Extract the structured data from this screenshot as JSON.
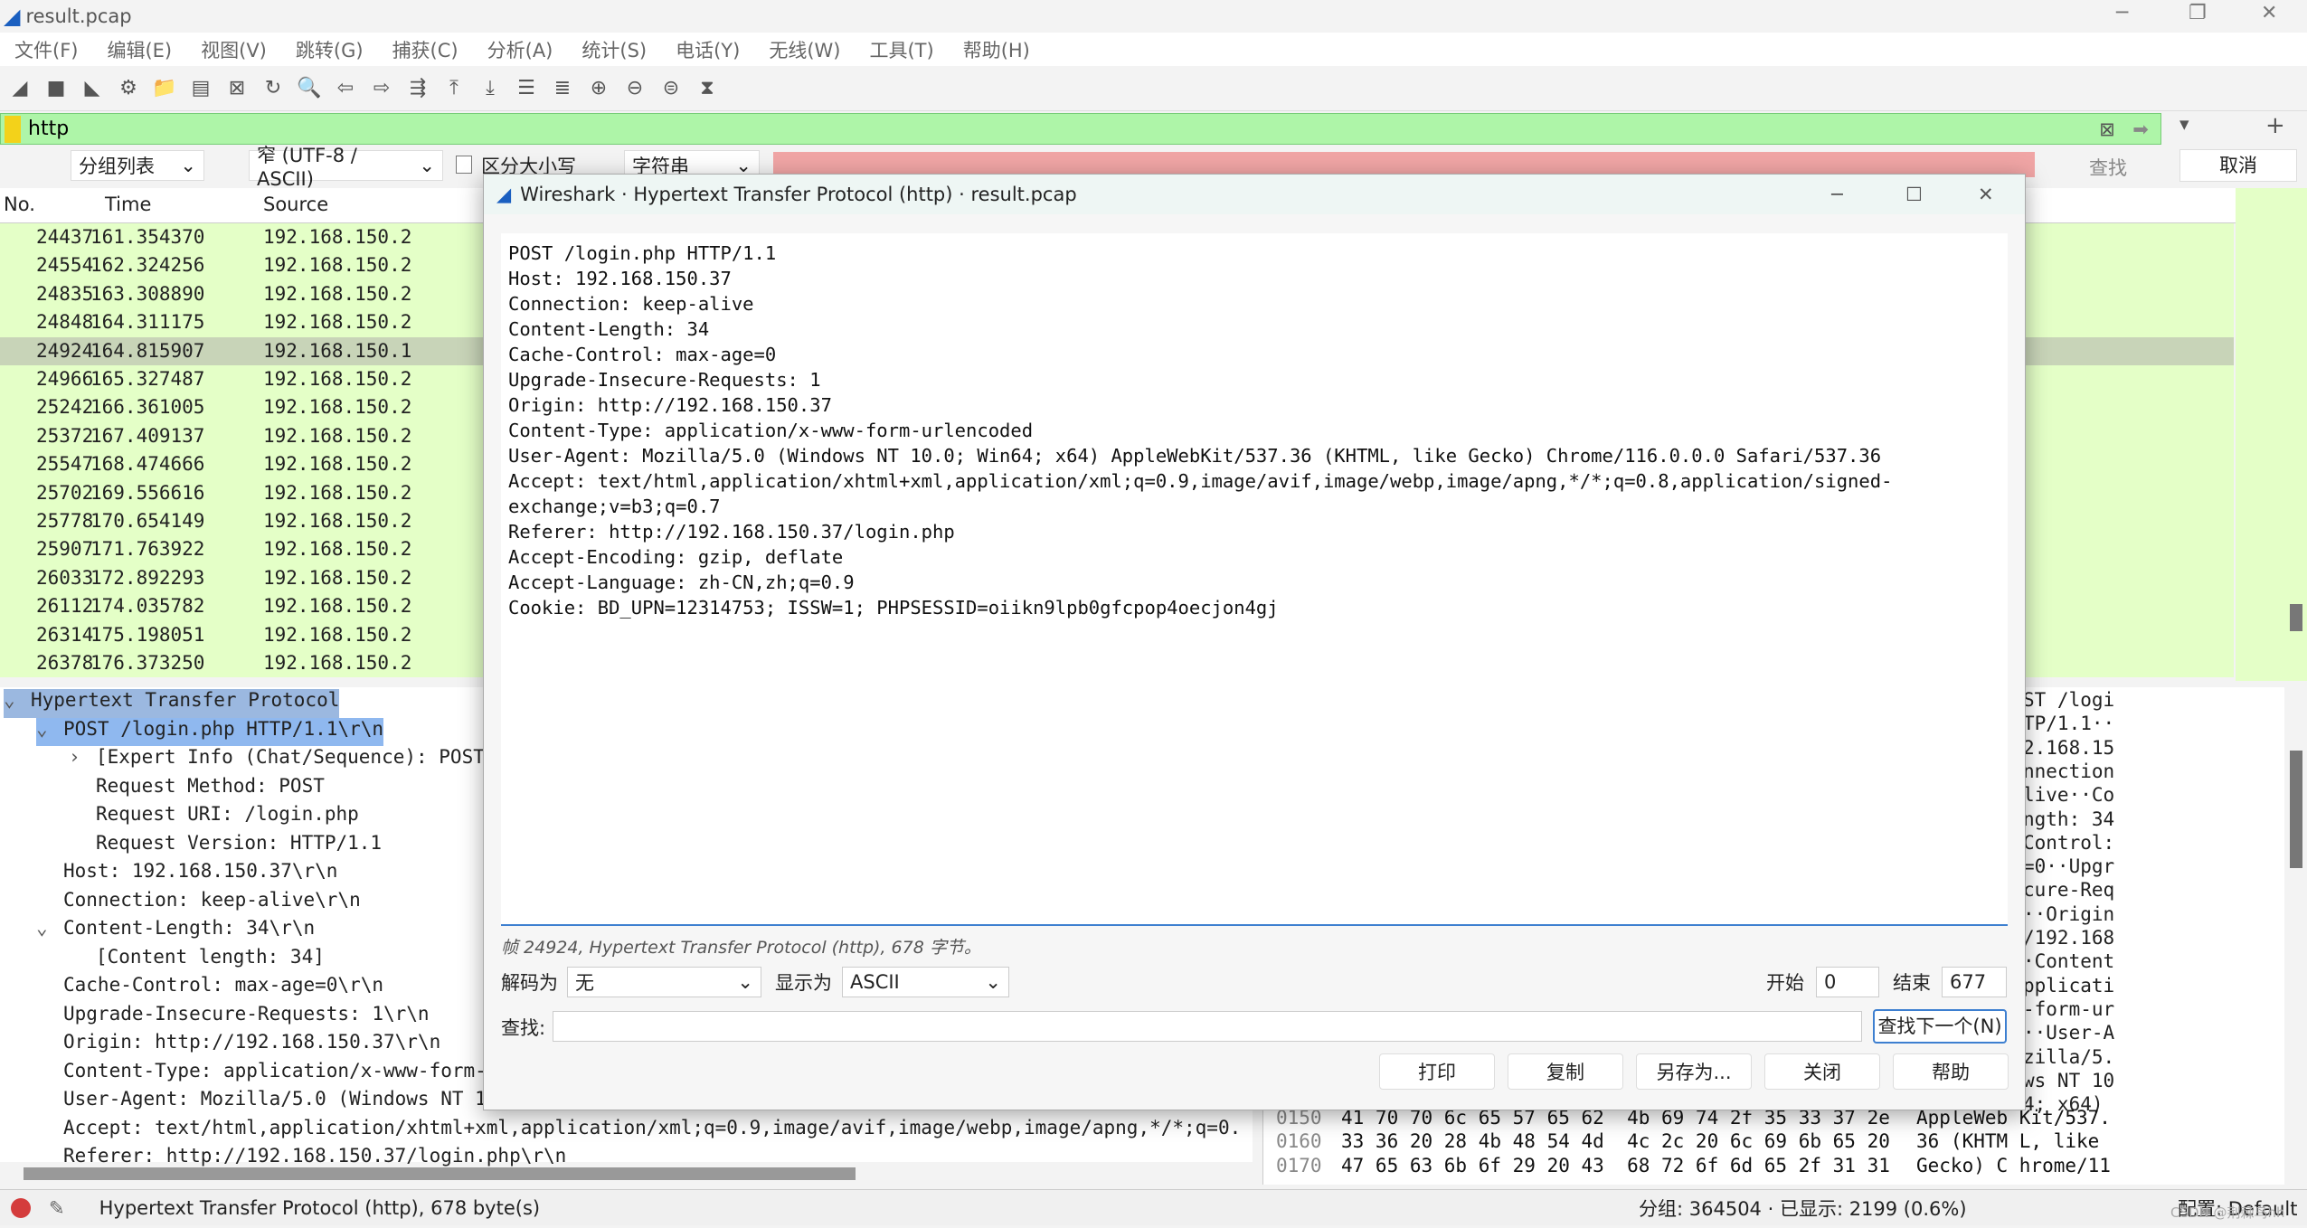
{
  "window": {
    "title": "result.pcap",
    "minimize": "─",
    "maximize": "❐",
    "close": "✕"
  },
  "menu": [
    "文件(F)",
    "编辑(E)",
    "视图(V)",
    "跳转(G)",
    "捕获(C)",
    "分析(A)",
    "统计(S)",
    "电话(Y)",
    "无线(W)",
    "工具(T)",
    "帮助(H)"
  ],
  "toolbar_icons": [
    "shark-fin-start-icon",
    "stop-icon",
    "restart-icon",
    "options-gear-icon",
    "open-folder-icon",
    "file-icon",
    "close-file-icon",
    "reload-icon",
    "find-icon",
    "back-icon",
    "forward-icon",
    "go-to-packet-icon",
    "first-packet-icon",
    "last-packet-icon",
    "autoscroll-icon",
    "colorize-icon",
    "zoom-in-icon",
    "zoom-out-icon",
    "zoom-normal-icon",
    "resize-columns-icon"
  ],
  "filter": {
    "value": "http"
  },
  "findbar": {
    "search_in": "分组列表",
    "charset": "窄 (UTF-8 / ASCII)",
    "case_label": "区分大小写",
    "type": "字符串",
    "find": "查找",
    "cancel": "取消"
  },
  "packet_list": {
    "columns": [
      "No.",
      "Time",
      "Source"
    ],
    "rows": [
      [
        "24437",
        "161.354370",
        "192.168.150.2"
      ],
      [
        "24554",
        "162.324256",
        "192.168.150.2"
      ],
      [
        "24835",
        "163.308890",
        "192.168.150.2"
      ],
      [
        "24848",
        "164.311175",
        "192.168.150.2"
      ],
      [
        "24924",
        "164.815907",
        "192.168.150.1"
      ],
      [
        "24966",
        "165.327487",
        "192.168.150.2"
      ],
      [
        "25242",
        "166.361005",
        "192.168.150.2"
      ],
      [
        "25372",
        "167.409137",
        "192.168.150.2"
      ],
      [
        "25547",
        "168.474666",
        "192.168.150.2"
      ],
      [
        "25702",
        "169.556616",
        "192.168.150.2"
      ],
      [
        "25778",
        "170.654149",
        "192.168.150.2"
      ],
      [
        "25907",
        "171.763922",
        "192.168.150.2"
      ],
      [
        "26033",
        "172.892293",
        "192.168.150.2"
      ],
      [
        "26112",
        "174.035782",
        "192.168.150.2"
      ],
      [
        "26314",
        "175.198051",
        "192.168.150.2"
      ],
      [
        "26378",
        "176.373250",
        "192.168.150.2"
      ]
    ]
  },
  "details": [
    {
      "t": "Hypertext Transfer Protocol",
      "e": "v",
      "l": 0
    },
    {
      "t": "POST /login.php HTTP/1.1\\r\\n",
      "e": "v",
      "l": 1
    },
    {
      "t": "[Expert Info (Chat/Sequence): POST",
      "e": ">",
      "l": 2
    },
    {
      "t": "Request Method: POST",
      "e": "",
      "l": 2
    },
    {
      "t": "Request URI: /login.php",
      "e": "",
      "l": 2
    },
    {
      "t": "Request Version: HTTP/1.1",
      "e": "",
      "l": 2
    },
    {
      "t": "Host: 192.168.150.37\\r\\n",
      "e": "",
      "l": 1
    },
    {
      "t": "Connection: keep-alive\\r\\n",
      "e": "",
      "l": 1
    },
    {
      "t": "Content-Length: 34\\r\\n",
      "e": "v",
      "l": 1
    },
    {
      "t": "[Content length: 34]",
      "e": "",
      "l": 2
    },
    {
      "t": "Cache-Control: max-age=0\\r\\n",
      "e": "",
      "l": 1
    },
    {
      "t": "Upgrade-Insecure-Requests: 1\\r\\n",
      "e": "",
      "l": 1
    },
    {
      "t": "Origin: http://192.168.150.37\\r\\n",
      "e": "",
      "l": 1
    },
    {
      "t": "Content-Type: application/x-www-form-",
      "e": "",
      "l": 1
    },
    {
      "t": "User-Agent: Mozilla/5.0 (Windows NT 1",
      "e": "",
      "l": 1
    },
    {
      "t": "Accept: text/html,application/xhtml+xml,application/xml;q=0.9,image/avif,image/webp,image/apng,*/*;q=0.",
      "e": "",
      "l": 1
    },
    {
      "t": "Referer: http://192.168.150.37/login.php\\r\\n",
      "e": "",
      "l": 1
    }
  ],
  "hex_ascii_partial": [
    "ST /logi",
    "TP/1.1··",
    "2.168.15",
    "nnection",
    "live··Co",
    "ngth: 34",
    "Control:",
    "=0··Upgr",
    "cure-Req",
    "··Origin",
    "/192.168",
    "·Content",
    "pplicati",
    "-form-ur",
    "··User-A",
    "zilla/5.",
    "ws NT 10",
    "4; x64)"
  ],
  "hex_rows": [
    [
      "0150",
      "41 70 70 6c 65 57 65 62  4b 69 74 2f 35 33 37 2e",
      "AppleWeb Kit/537."
    ],
    [
      "0160",
      "33 36 20 28 4b 48 54 4d  4c 2c 20 6c 69 6b 65 20",
      "36 (KHTM L, like"
    ],
    [
      "0170",
      "47 65 63 6b 6f 29 20 43  68 72 6f 6d 65 2f 31 31",
      "Gecko) C hrome/11"
    ]
  ],
  "status": {
    "left": "Hypertext Transfer Protocol (http), 678 byte(s)",
    "packets": "分组: 364504 · 已显示: 2199 (0.6%)",
    "profile": "配置: Default",
    "watermark": "CSDN @荆棘鸟hh"
  },
  "dialog": {
    "title": "Wireshark · Hypertext Transfer Protocol (http) · result.pcap",
    "content": "POST /login.php HTTP/1.1\nHost: 192.168.150.37\nConnection: keep-alive\nContent-Length: 34\nCache-Control: max-age=0\nUpgrade-Insecure-Requests: 1\nOrigin: http://192.168.150.37\nContent-Type: application/x-www-form-urlencoded\nUser-Agent: Mozilla/5.0 (Windows NT 10.0; Win64; x64) AppleWebKit/537.36 (KHTML, like Gecko) Chrome/116.0.0.0 Safari/537.36\nAccept: text/html,application/xhtml+xml,application/xml;q=0.9,image/avif,image/webp,image/apng,*/*;q=0.8,application/signed-exchange;v=b3;q=0.7\nReferer: http://192.168.150.37/login.php\nAccept-Encoding: gzip, deflate\nAccept-Language: zh-CN,zh;q=0.9\nCookie: BD_UPN=12314753; ISSW=1; PHPSESSID=oiikn9lpb0gfcpop4oecjon4gj",
    "caption": "帧 24924, Hypertext Transfer Protocol (http), 678 字节。",
    "decode_label": "解码为",
    "decode_value": "无",
    "show_label": "显示为",
    "show_value": "ASCII",
    "start_label": "开始",
    "start_value": "0",
    "end_label": "结束",
    "end_value": "677",
    "find_label": "查找:",
    "find_next": "查找下一个(N)",
    "buttons": [
      "打印",
      "复制",
      "另存为...",
      "关闭",
      "帮助"
    ]
  },
  "colors": {
    "filter_bg": "#aef5a8",
    "packet_row": "#e4ffc7",
    "selected_detail": "#8fb8ef",
    "accent": "#3d7fd0"
  }
}
